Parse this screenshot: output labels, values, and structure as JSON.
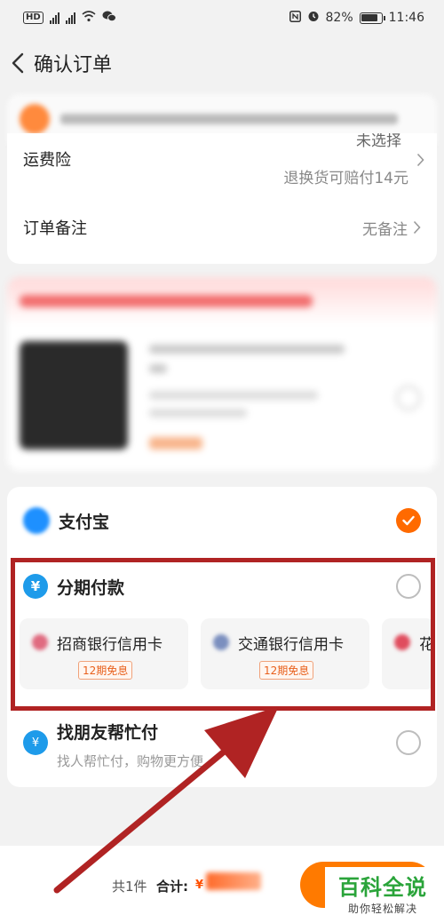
{
  "status_bar": {
    "sim": "HD",
    "signal1": "4G",
    "signal2": "4G",
    "battery": "82%",
    "time": "11:46"
  },
  "header": {
    "title": "确认订单"
  },
  "shipping": {
    "insurance_label": "运费险",
    "insurance_value": "未选择",
    "insurance_sub": "退换货可赔付14元",
    "note_label": "订单备注",
    "note_value": "无备注"
  },
  "payment": {
    "alipay": {
      "name": "支付宝",
      "selected": true
    },
    "installment": {
      "name": "分期付款",
      "banks": [
        {
          "name": "招商银行信用卡",
          "badge": "12期免息"
        },
        {
          "name": "交通银行信用卡",
          "badge": "12期免息"
        },
        {
          "name": "花",
          "badge": ""
        }
      ]
    },
    "friend": {
      "name": "找朋友帮忙付",
      "desc": "找人帮忙付，购物更方便"
    }
  },
  "footer": {
    "count": "共1件",
    "total_label": "合计:",
    "currency": "¥"
  },
  "watermark": {
    "title": "百科全说",
    "subtitle": "助你轻松解决"
  },
  "colors": {
    "accent": "#ff6a00",
    "highlight_box": "#b02323",
    "arrow": "#b02323",
    "watermark": "#2aa43a"
  }
}
